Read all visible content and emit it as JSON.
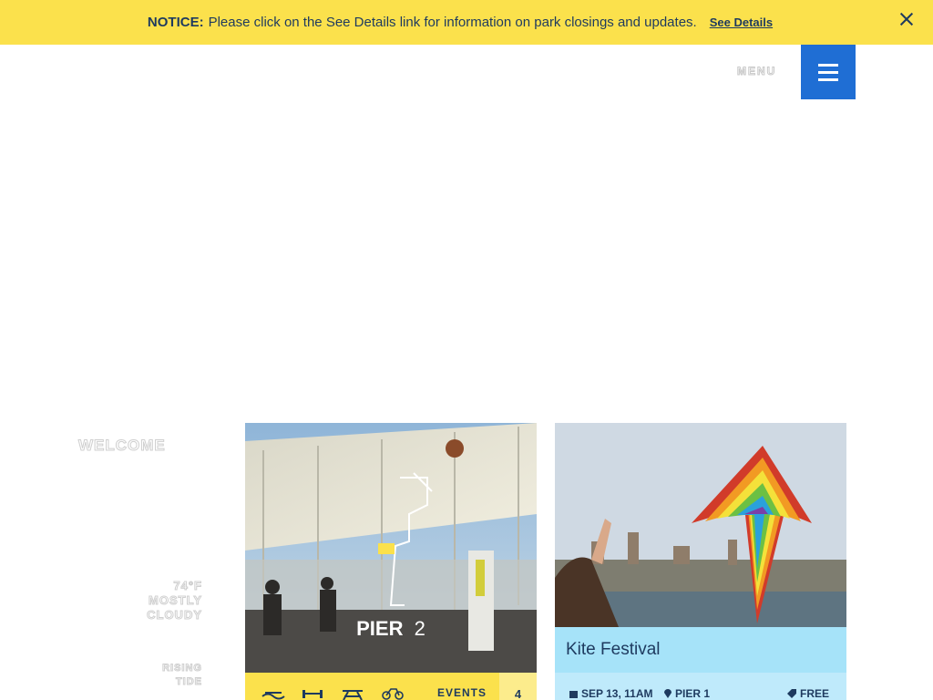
{
  "notice": {
    "label": "NOTICE:",
    "message": "Please click on the See Details link for information on park closings and updates.",
    "link": "See Details",
    "close_icon": "close-icon"
  },
  "menu": {
    "label": "MENU",
    "icon": "hamburger-icon",
    "accent": "#1f6ed4"
  },
  "sidebar": {
    "welcome": "WELCOME",
    "temperature": "74°F",
    "condition_line1": "MOSTLY",
    "condition_line2": "CLOUDY",
    "tide_line1": "RISING",
    "tide_line2": "TIDE"
  },
  "pier_card": {
    "title_bold": "PIER",
    "title_num": "2",
    "amenity_icons": [
      "water-icon",
      "fitness-icon",
      "picnic-table-icon",
      "bicycle-icon"
    ],
    "events_label": "EVENTS",
    "events_count": "4",
    "footer_color": "#fbe14c"
  },
  "event_card": {
    "title": "Kite Festival",
    "date": "SEP 13, 11AM",
    "location": "PIER 1",
    "price": "FREE",
    "title_bar_color": "#a6e3f9"
  }
}
